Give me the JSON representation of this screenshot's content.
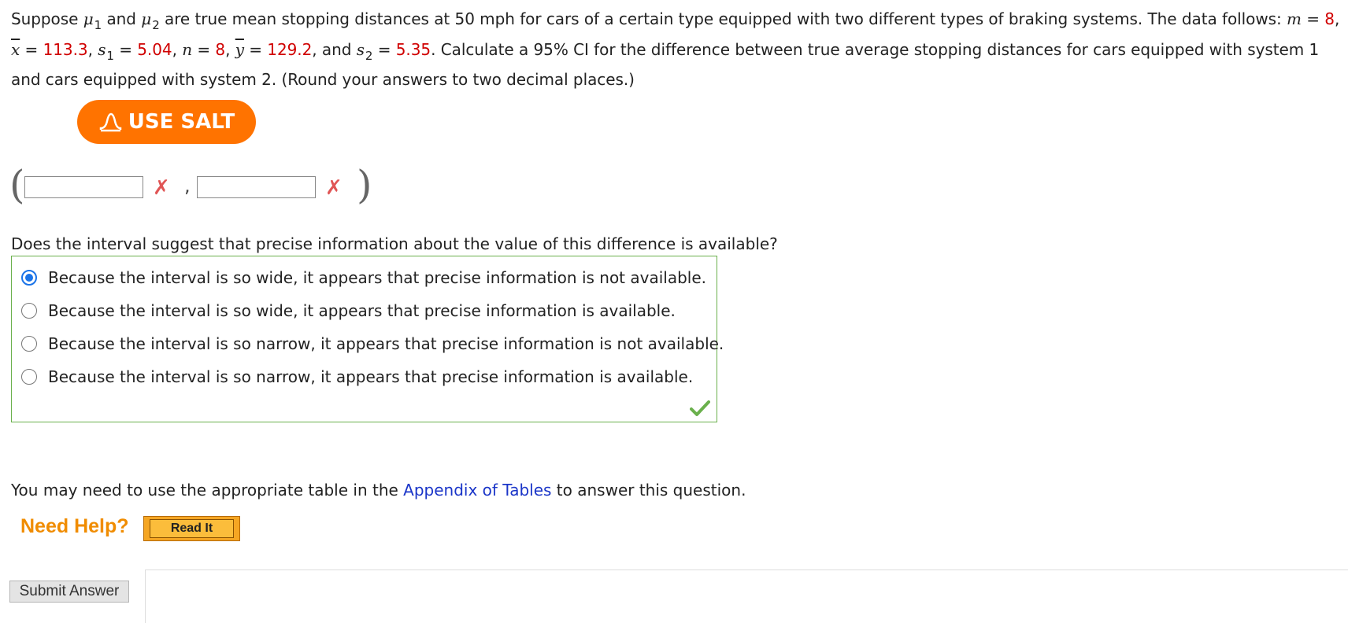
{
  "question": {
    "t1": "Suppose ",
    "mu": "μ",
    "sub1": "1",
    "and": " and ",
    "sub2": "2",
    "t2": " are true mean stopping distances at 50 mph for cars of a certain type equipped with two different types of braking systems. The data follows: ",
    "m_var": "m",
    "eq": " = ",
    "m_val": "8",
    "comma": ",",
    "x_var": "x",
    "x_val": "113.3",
    "s_var": "s",
    "s1_val": "5.04",
    "n_var": "n",
    "n_val": "8",
    "y_var": "y",
    "y_val": "129.2",
    "and2": ", and ",
    "s2_val": "5.35",
    "t3": ". Calculate a 95% CI for the difference between true average stopping distances for cars equipped with system 1 and cars equipped with system 2. (Round your answers to two decimal places.)"
  },
  "salt_button": {
    "label": "USE SALT"
  },
  "ci": {
    "open_paren": "(",
    "close_paren": ")",
    "separator": ",",
    "lower_value": "",
    "upper_value": "",
    "incorrect_mark": "✗"
  },
  "mc": {
    "prompt": "Does the interval suggest that precise information about the value of this difference is available?",
    "options": [
      "Because the interval is so wide, it appears that precise information is not available.",
      "Because the interval is so wide, it appears that precise information is available.",
      "Because the interval is so narrow, it appears that precise information is not available.",
      "Because the interval is so narrow, it appears that precise information is available."
    ],
    "selected_index": 0
  },
  "appendix": {
    "before": "You may need to use the appropriate table in the ",
    "link": "Appendix of Tables",
    "after": " to answer this question."
  },
  "help": {
    "label": "Need Help?",
    "read_it": "Read It"
  },
  "submit": {
    "label": "Submit Answer"
  },
  "colors": {
    "given_value": "#d00000",
    "salt_orange": "#ff7300",
    "link_blue": "#1a35c8",
    "correct_green": "#6ab04c",
    "incorrect_red": "#e05555"
  }
}
